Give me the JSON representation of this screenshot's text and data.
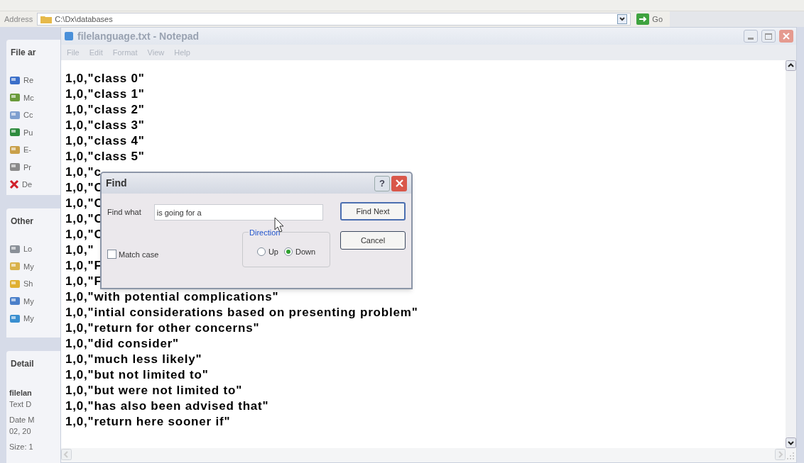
{
  "address_bar": {
    "label": "Address",
    "value": "C:\\Dx\\databases",
    "go_button": "Go"
  },
  "task_pane": {
    "panels": [
      {
        "title": "File ar",
        "items": [
          "Re",
          "Mc",
          "Cc",
          "Pu",
          "E-",
          "Pr",
          "De"
        ]
      },
      {
        "title": "Other",
        "items": [
          "Lo",
          "My",
          "Sh",
          "My",
          "My"
        ]
      },
      {
        "title": "Detail",
        "lines": [
          {
            "kind": "name",
            "text": "filelan"
          },
          {
            "kind": "line",
            "text": "Text D"
          },
          {
            "kind": "gap",
            "text": "Date M"
          },
          {
            "kind": "line",
            "text": "02, 20"
          },
          {
            "kind": "gap",
            "text": "Size: 1"
          }
        ]
      }
    ]
  },
  "notepad": {
    "title": "filelanguage.txt - Notepad",
    "menu": [
      "File",
      "Edit",
      "Format",
      "View",
      "Help"
    ],
    "lines": [
      "1,0,\"class 0\"",
      "1,0,\"class 1\"",
      "1,0,\"class 2\"",
      "1,0,\"class 3\"",
      "1,0,\"class 4\"",
      "1,0,\"class 5\"",
      "1,0,\"c",
      "1,0,\"C",
      "1,0,\"C",
      "1,0,\"C",
      "1,0,\"C",
      "1,0,\"",
      "1,0,\"F",
      "1,0,\"F",
      "1,0,\"with potential complications\"",
      "1,0,\"intial considerations based on presenting problem\"",
      "1,0,\"return for other concerns\"",
      "1,0,\"did consider\"",
      "1,0,\"much less likely\"",
      "1,0,\"but not limited to\"",
      "1,0,\"but were not limited to\"",
      "1,0,\"has also been advised that\"",
      "1,0,\"return here sooner if\""
    ]
  },
  "find_dialog": {
    "title": "Find",
    "help_button": "?",
    "find_what_label": "Find what",
    "find_what_value": "is going for a",
    "find_next_button": "Find Next",
    "cancel_button": "Cancel",
    "direction_label": "Direction",
    "directions": [
      {
        "label": "Up",
        "selected": false
      },
      {
        "label": "Down",
        "selected": true
      }
    ],
    "match_case": {
      "label": "Match case",
      "checked": false
    }
  }
}
